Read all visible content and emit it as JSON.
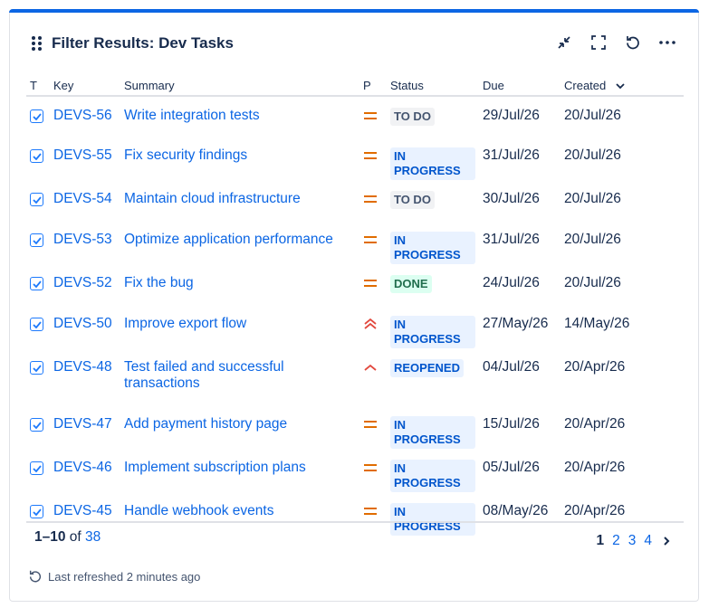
{
  "gadget": {
    "title": "Filter Results: Dev Tasks",
    "accent": "#0c66e4"
  },
  "columns": {
    "type": "T",
    "key": "Key",
    "summary": "Summary",
    "priority": "P",
    "status": "Status",
    "due": "Due",
    "created": "Created"
  },
  "rows": [
    {
      "key": "DEVS-56",
      "summary": "Write integration tests",
      "priority": "medium",
      "status": "TO DO",
      "due": "29/Jul/26",
      "created": "20/Jul/26"
    },
    {
      "key": "DEVS-55",
      "summary": "Fix security findings",
      "priority": "medium",
      "status": "IN PROGRESS",
      "due": "31/Jul/26",
      "created": "20/Jul/26"
    },
    {
      "key": "DEVS-54",
      "summary": "Maintain cloud infrastructure",
      "priority": "medium",
      "status": "TO DO",
      "due": "30/Jul/26",
      "created": "20/Jul/26"
    },
    {
      "key": "DEVS-53",
      "summary": "Optimize application performance",
      "priority": "medium",
      "status": "IN PROGRESS",
      "due": "31/Jul/26",
      "created": "20/Jul/26"
    },
    {
      "key": "DEVS-52",
      "summary": "Fix the bug",
      "priority": "medium",
      "status": "DONE",
      "due": "24/Jul/26",
      "created": "20/Jul/26"
    },
    {
      "key": "DEVS-50",
      "summary": "Improve export flow",
      "priority": "highest",
      "status": "IN PROGRESS",
      "due": "27/May/26",
      "created": "14/May/26"
    },
    {
      "key": "DEVS-48",
      "summary": "Test failed and successful transactions",
      "priority": "high",
      "status": "REOPENED",
      "due": "04/Jul/26",
      "created": "20/Apr/26"
    },
    {
      "key": "DEVS-47",
      "summary": "Add payment history page",
      "priority": "medium",
      "status": "IN PROGRESS",
      "due": "15/Jul/26",
      "created": "20/Apr/26"
    },
    {
      "key": "DEVS-46",
      "summary": "Implement subscription plans",
      "priority": "medium",
      "status": "IN PROGRESS",
      "due": "05/Jul/26",
      "created": "20/Apr/26"
    },
    {
      "key": "DEVS-45",
      "summary": "Handle webhook events",
      "priority": "medium",
      "status": "IN PROGRESS",
      "due": "08/May/26",
      "created": "20/Apr/26"
    }
  ],
  "pagination": {
    "range": "1–10",
    "of": "of",
    "total": "38",
    "pages": [
      "1",
      "2",
      "3",
      "4"
    ],
    "current": "1"
  },
  "footer": {
    "refreshed": "Last refreshed 2 minutes ago"
  },
  "icons": {
    "drag": "drag-handle-icon",
    "minimize": "minimize-icon",
    "fullscreen": "fullscreen-icon",
    "refresh": "refresh-icon",
    "more": "more-icon",
    "task": "task-checkbox-icon",
    "priority_medium": "priority-medium-icon",
    "priority_high": "priority-high-icon",
    "priority_highest": "priority-highest-icon",
    "sort": "chevron-down-icon",
    "next": "chevron-right-icon"
  }
}
